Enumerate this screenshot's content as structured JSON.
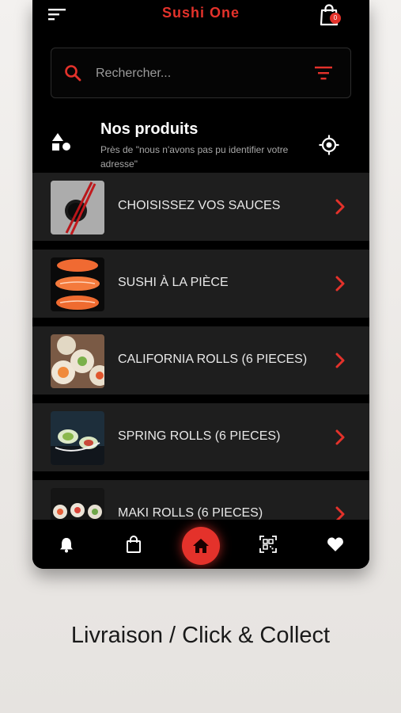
{
  "header": {
    "title": "Sushi One",
    "cart_count": "0"
  },
  "search": {
    "placeholder": "Rechercher..."
  },
  "section": {
    "title": "Nos produits",
    "subtitle": "Près de \"nous n'avons pas pu identifier votre adresse\""
  },
  "categories": [
    {
      "label": "CHOISISSEZ VOS SAUCES",
      "thumb": "sauce-chopsticks"
    },
    {
      "label": "SUSHI À LA PIÈCE",
      "thumb": "salmon-nigiri"
    },
    {
      "label": "CALIFORNIA ROLLS (6 PIECES)",
      "thumb": "california-rolls"
    },
    {
      "label": "SPRING ROLLS (6 PIECES)",
      "thumb": "spring-rolls"
    },
    {
      "label": "MAKI ROLLS (6 PIECES)",
      "thumb": "maki-rolls"
    }
  ],
  "bottom_nav": {
    "items": [
      "bell-icon",
      "shopping-bag-icon",
      "home-icon",
      "qr-code-icon",
      "heart-icon"
    ],
    "active": "home-icon"
  },
  "caption": "Livraison / Click & Collect",
  "colors": {
    "accent": "#e4322b",
    "background": "#000000",
    "row": "#1e1e1e",
    "page": "#efedeb"
  }
}
